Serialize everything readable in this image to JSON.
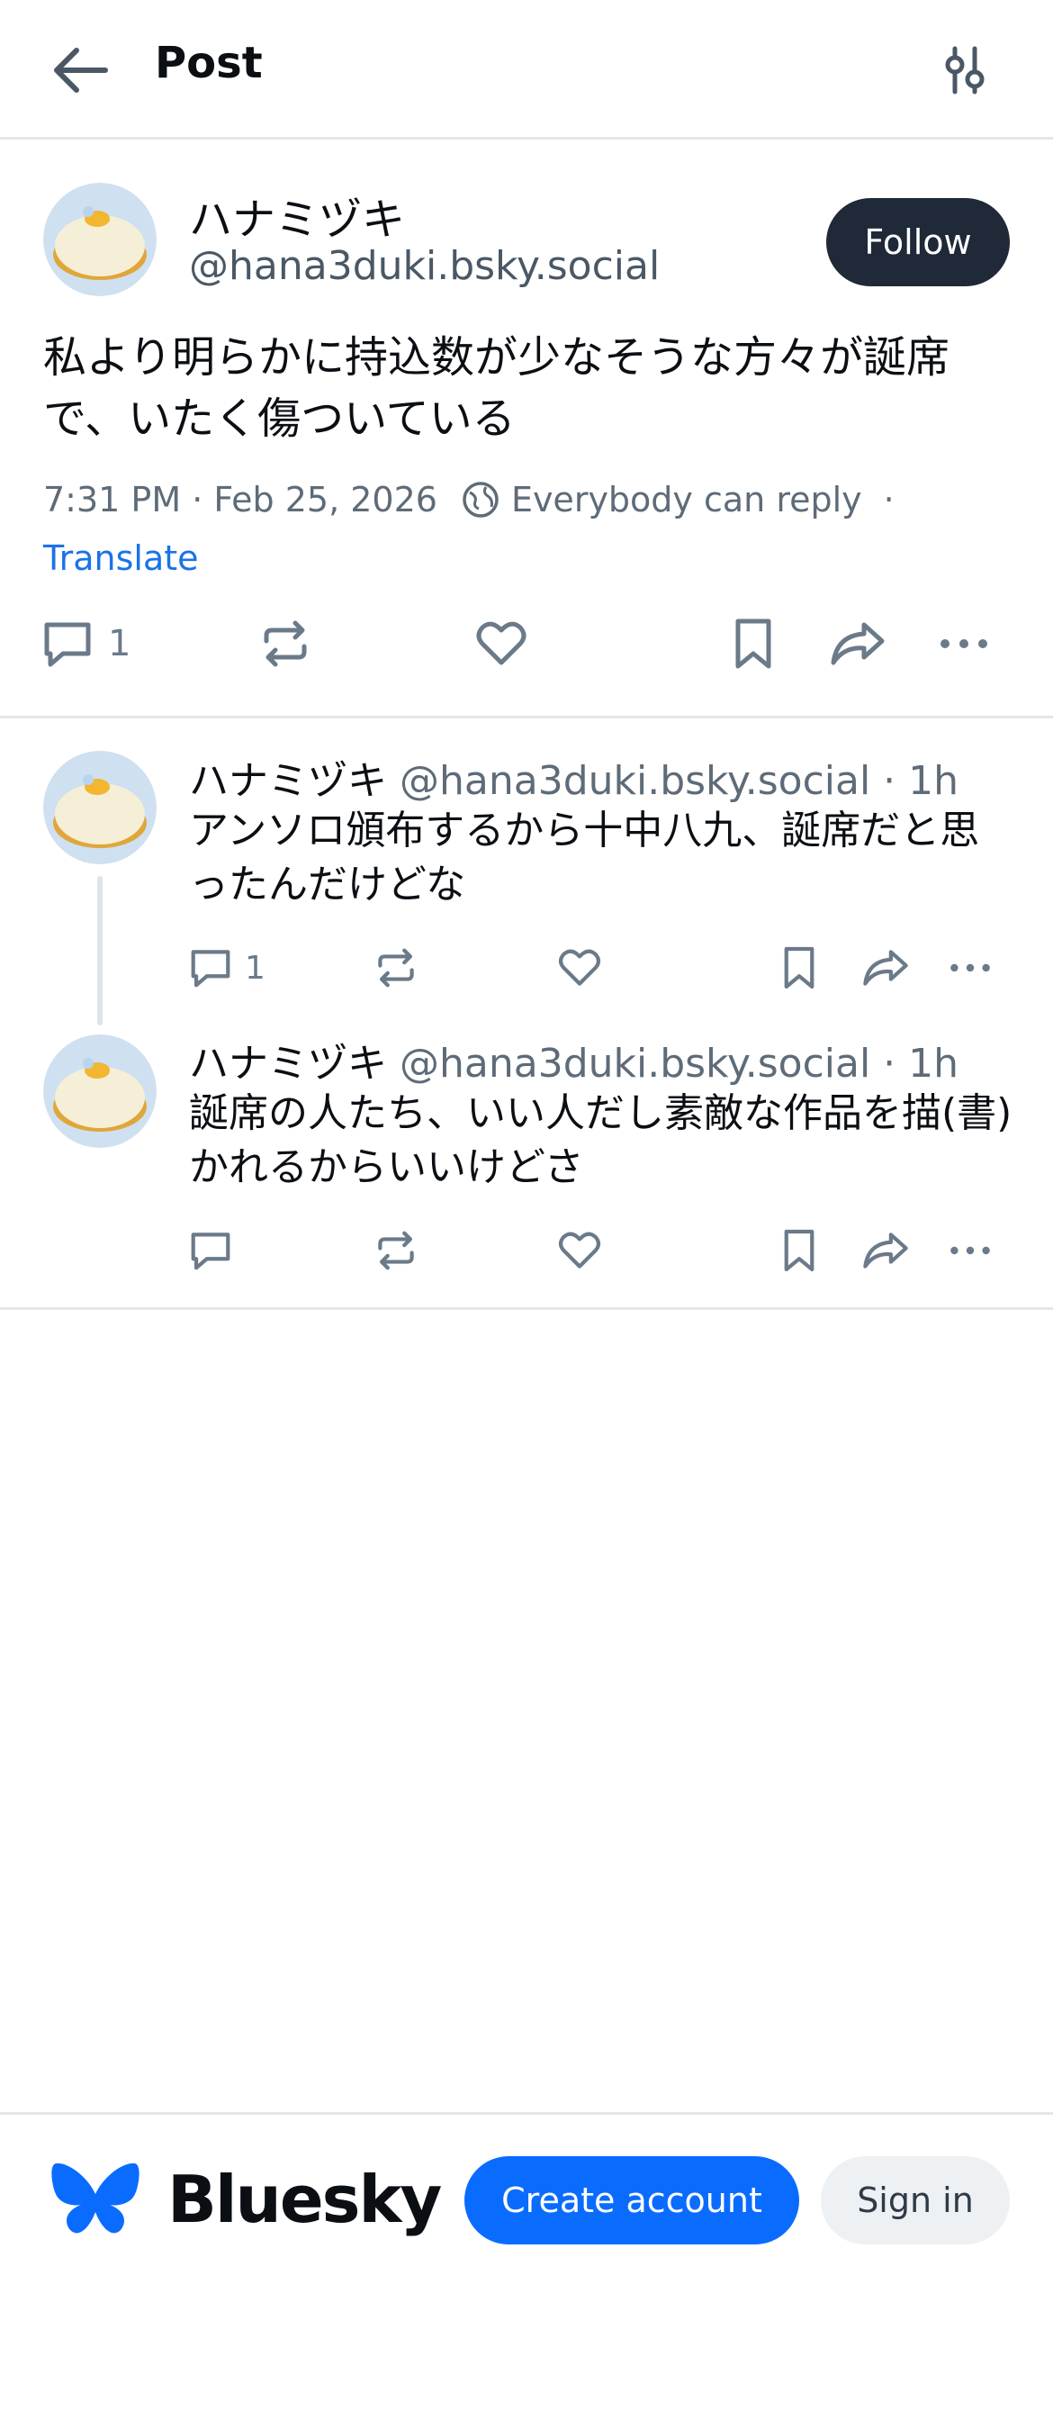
{
  "header": {
    "title": "Post",
    "back_icon": "arrow-left-icon",
    "settings_icon": "sliders-icon"
  },
  "main_post": {
    "author_name": "ハナミヅキ",
    "author_handle": "@hana3duki.bsky.social",
    "follow_label": "Follow",
    "text": "私より明らかに持込数が少なそうな方々が誕席で、いたく傷ついている",
    "timestamp": "7:31 PM · Feb 25, 2026",
    "reply_setting": "Everybody can reply",
    "meta_separator": "·",
    "translate_label": "Translate",
    "reply_count": "1"
  },
  "replies": [
    {
      "author_name": "ハナミヅキ",
      "author_handle": "@hana3duki.bsky.social · 1h",
      "text": "アンソロ頒布するから十中八九、誕席だと思ったんだけどな",
      "reply_count": "1"
    },
    {
      "author_name": "ハナミヅキ",
      "author_handle": "@hana3duki.bsky.social · 1h",
      "text": "誕席の人たち、いい人だし素敵な作品を描(書)かれるからいいけどさ",
      "reply_count": ""
    }
  ],
  "footer": {
    "logo_text": "Bluesky",
    "create_account_label": "Create account",
    "sign_in_label": "Sign in"
  },
  "colors": {
    "brand_blue": "#0a6cff",
    "follow_bg": "#1f2937",
    "link_blue": "#1a73e8",
    "icon_gray": "#6b7a89"
  }
}
